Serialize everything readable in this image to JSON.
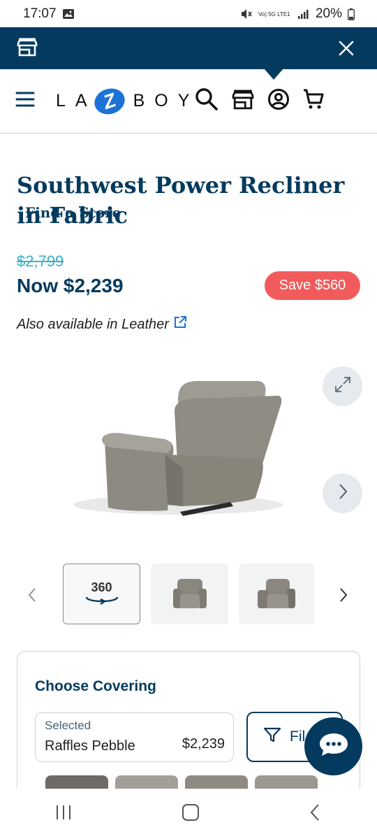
{
  "status": {
    "time": "17:07",
    "signal_label": "Vo) 5G LTE1",
    "battery": "20%"
  },
  "store_banner": {
    "label": "Find a Store"
  },
  "brand": {
    "left": "LA",
    "z": "Z",
    "right": "BOY"
  },
  "product": {
    "title": "Southwest Power Recliner in Fabric",
    "was_price": "$2,799",
    "now_price": "Now $2,239",
    "save_badge": "Save $560",
    "also_available": "Also available in Leather"
  },
  "gallery": {
    "thumb_360_label": "360"
  },
  "covering": {
    "heading": "Choose Covering",
    "selected_label": "Selected",
    "selected_value": "Raffles Pebble",
    "selected_price": "$2,239",
    "filter_label": "Fil"
  },
  "colors": {
    "brand_navy": "#043a5e",
    "sale_red": "#f25b5b",
    "strike_teal": "#3bb0c9",
    "logo_blue": "#1d72d6"
  }
}
